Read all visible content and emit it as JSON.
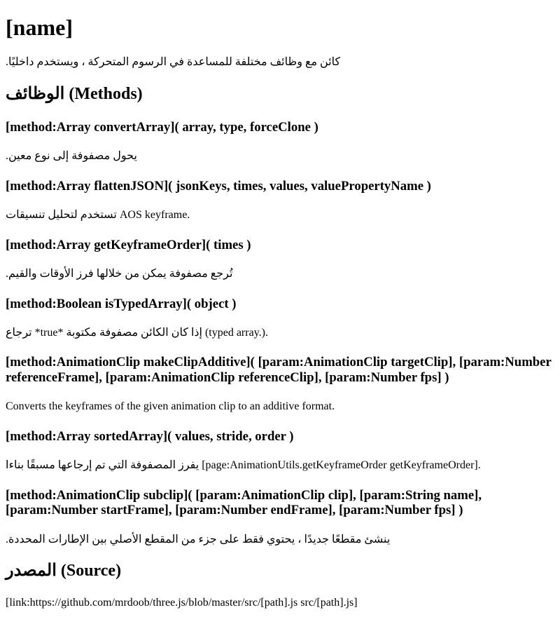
{
  "page_title": "[name]",
  "intro": ".كائن مع وظائف مختلفة للمساعدة في الرسوم المتحركة ، ويستخدم داخليًا",
  "methods_heading": "الوظائف (Methods)",
  "methods": [
    {
      "signature": "[method:Array convertArray]( array, type, forceClone )",
      "description": ".يحول مصفوفة إلى نوع معين"
    },
    {
      "signature": "[method:Array flattenJSON]( jsonKeys, times, values, valuePropertyName )",
      "description": "تستخدم لتحليل تنسيقات AOS keyframe."
    },
    {
      "signature": "[method:Array getKeyframeOrder]( times )",
      "description": ".تُرجع مصفوفة يمكن من خلالها فرز الأوقات والقيم"
    },
    {
      "signature": "[method:Boolean isTypedArray]( object )",
      "description": "ترجاع *true* إذا كان الكائن مصفوفة مكتوبة (typed array.)."
    },
    {
      "signature": "[method:AnimationClip makeClipAdditive]( [param:AnimationClip targetClip], [param:Number referenceFrame], [param:AnimationClip referenceClip], [param:Number fps] )",
      "description": "Converts the keyframes of the given animation clip to an additive format."
    },
    {
      "signature": "[method:Array sortedArray]( values, stride, order )",
      "description": "يفرز المصفوفة التي تم إرجاعها مسبقًا بناءا [page:AnimationUtils.getKeyframeOrder getKeyframeOrder]."
    },
    {
      "signature": "[method:AnimationClip subclip]( [param:AnimationClip clip], [param:String name], [param:Number startFrame], [param:Number endFrame], [param:Number fps] )",
      "description": ".ينشئ مقطعًا جديدًا ، يحتوي فقط على جزء من المقطع الأصلي بين الإطارات المحددة"
    }
  ],
  "source_heading": "المصدر (Source)",
  "source_link": "[link:https://github.com/mrdoob/three.js/blob/master/src/[path].js src/[path].js]"
}
